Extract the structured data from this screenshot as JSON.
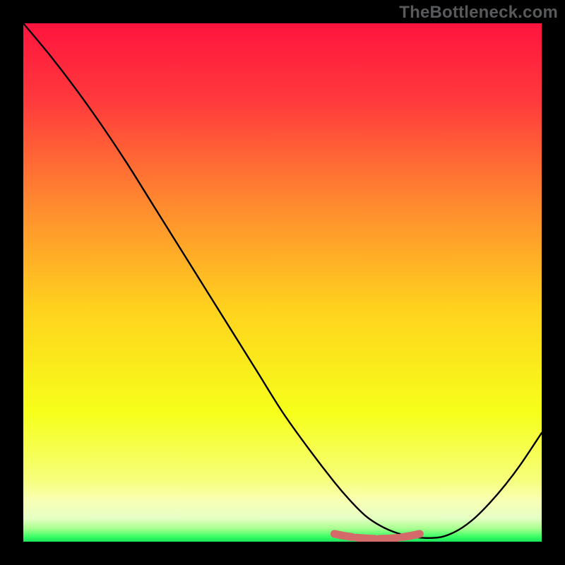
{
  "watermark": "TheBottleneck.com",
  "chart_data": {
    "type": "line",
    "title": "",
    "xlabel": "",
    "ylabel": "",
    "xlim": [
      0,
      100
    ],
    "ylim": [
      0,
      100
    ],
    "series": [
      {
        "name": "curve",
        "x": [
          0,
          5,
          10,
          15,
          20,
          25,
          30,
          35,
          40,
          45,
          50,
          55,
          60,
          63,
          66,
          69,
          72,
          75,
          78,
          81,
          84,
          87,
          90,
          93,
          96,
          100
        ],
        "values": [
          100,
          94,
          87.5,
          80.5,
          73,
          65,
          57,
          49,
          41,
          33,
          25,
          18,
          11.5,
          8,
          5,
          3,
          1.7,
          1,
          0.7,
          1,
          2.3,
          4.5,
          7.5,
          11,
          15,
          21
        ]
      }
    ],
    "gradient_stops": [
      {
        "offset": 0.0,
        "color": "#ff143e"
      },
      {
        "offset": 0.15,
        "color": "#ff3a3d"
      },
      {
        "offset": 0.35,
        "color": "#ff8a2f"
      },
      {
        "offset": 0.55,
        "color": "#ffd21e"
      },
      {
        "offset": 0.75,
        "color": "#f6ff1a"
      },
      {
        "offset": 0.88,
        "color": "#f6ff7a"
      },
      {
        "offset": 0.92,
        "color": "#f8ffb4"
      },
      {
        "offset": 0.955,
        "color": "#e6ffc4"
      },
      {
        "offset": 0.975,
        "color": "#a6ff8e"
      },
      {
        "offset": 0.99,
        "color": "#3dff66"
      },
      {
        "offset": 1.0,
        "color": "#18e35a"
      }
    ],
    "marker": {
      "color": "#d46a6a",
      "description": "rounded red segment near curve minimum",
      "x_range_pct": [
        60,
        77
      ],
      "y_pct": 1.1
    }
  }
}
